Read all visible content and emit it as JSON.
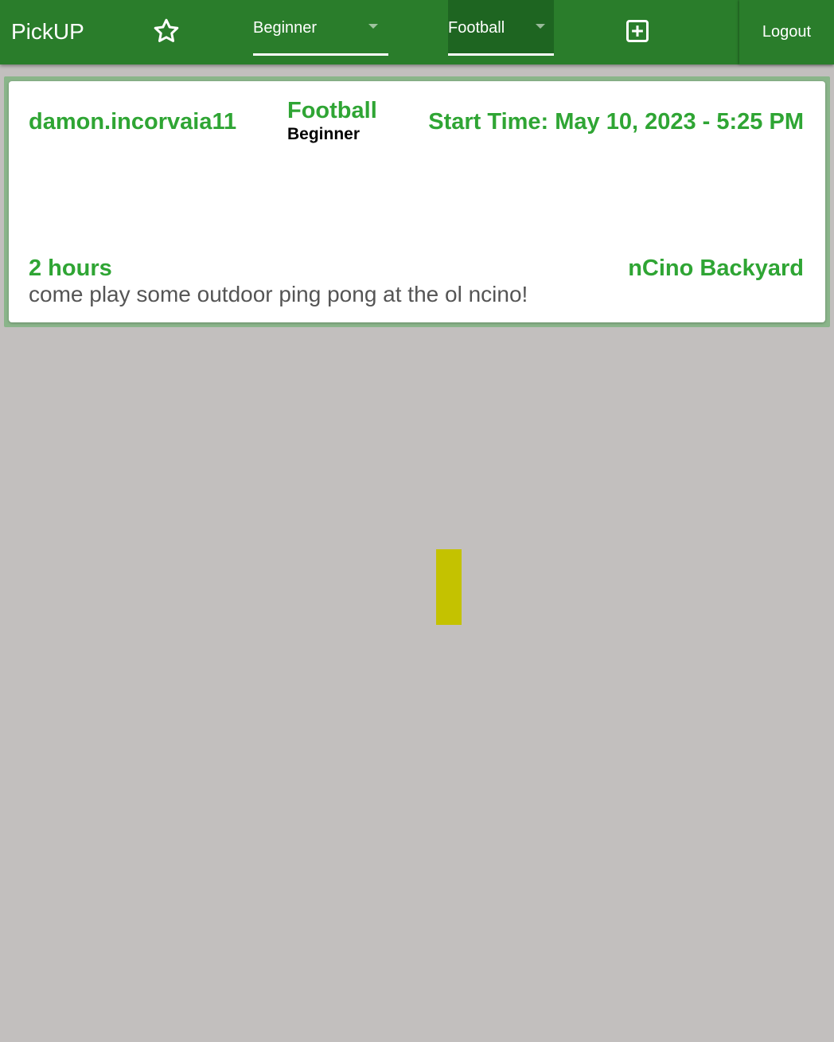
{
  "appbar": {
    "brand": "PickUP",
    "favorites_icon": "star-outline-icon",
    "level_filter": {
      "selected": "Beginner"
    },
    "sport_filter": {
      "selected": "Football"
    },
    "add_icon": "plus-square-icon",
    "logout_label": "Logout",
    "colors": {
      "bar": "#2a7d2b",
      "active_dropdown": "#1e6521"
    }
  },
  "games": [
    {
      "host": "damon.incorvaia11",
      "sport": "Football",
      "level": "Beginner",
      "start_time": "Start Time: May 10, 2023 - 5:25 PM",
      "duration": "2 hours",
      "location": "nCino Backyard",
      "description": "come play some outdoor ping pong at the ol ncino!"
    }
  ],
  "colors": {
    "accent_green": "#2fa534",
    "background": "#c2bfbe",
    "card_border": "#8ab58a",
    "yellow_block": "#c4c200"
  }
}
